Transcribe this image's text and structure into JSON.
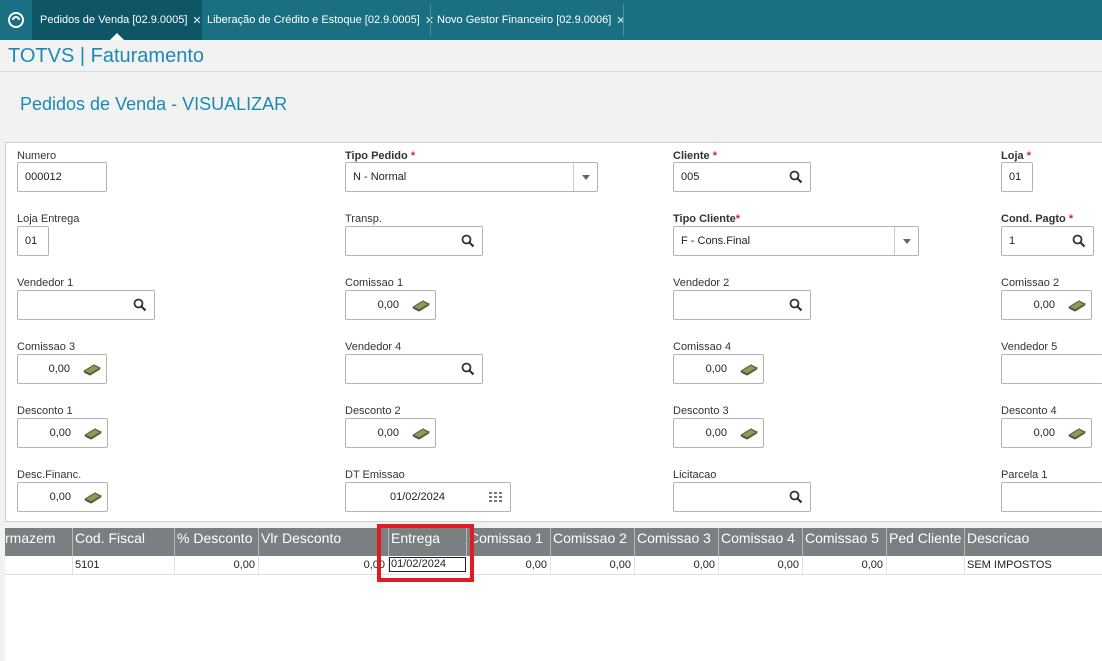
{
  "tabs": [
    {
      "label": "Pedidos de Venda [02.9.0005]",
      "active": true
    },
    {
      "label": "Liberação de Crédito e Estoque [02.9.0005]",
      "active": false
    },
    {
      "label": "Novo Gestor Financeiro [02.9.0006]",
      "active": false
    }
  ],
  "app_title": "TOTVS | Faturamento",
  "page_title": "Pedidos de Venda - VISUALIZAR",
  "form": {
    "numero": {
      "label": "Numero",
      "value": "000012"
    },
    "tipo_pedido": {
      "label": "Tipo Pedido",
      "value": "N - Normal"
    },
    "cliente": {
      "label": "Cliente",
      "value": "005"
    },
    "loja": {
      "label": "Loja",
      "value": "01"
    },
    "loja_entrega": {
      "label": "Loja Entrega",
      "value": "01"
    },
    "transp": {
      "label": "Transp.",
      "value": ""
    },
    "tipo_cliente": {
      "label": "Tipo Cliente",
      "value": "F - Cons.Final"
    },
    "cond_pagto": {
      "label": "Cond. Pagto",
      "value": "1"
    },
    "vendedor1": {
      "label": "Vendedor 1",
      "value": ""
    },
    "comissao1": {
      "label": "Comissao 1",
      "value": "0,00"
    },
    "vendedor2": {
      "label": "Vendedor 2",
      "value": ""
    },
    "comissao2": {
      "label": "Comissao 2",
      "value": "0,00"
    },
    "comissao3": {
      "label": "Comissao 3",
      "value": "0,00"
    },
    "vendedor4": {
      "label": "Vendedor 4",
      "value": ""
    },
    "comissao4": {
      "label": "Comissao 4",
      "value": "0,00"
    },
    "vendedor5": {
      "label": "Vendedor 5",
      "value": ""
    },
    "desconto1": {
      "label": "Desconto 1",
      "value": "0,00"
    },
    "desconto2": {
      "label": "Desconto 2",
      "value": "0,00"
    },
    "desconto3": {
      "label": "Desconto 3",
      "value": "0,00"
    },
    "desconto4": {
      "label": "Desconto 4",
      "value": "0,00"
    },
    "desc_financ": {
      "label": "Desc.Financ.",
      "value": "0,00"
    },
    "dt_emissao": {
      "label": "DT Emissao",
      "value": "01/02/2024"
    },
    "licitacao": {
      "label": "Licitacao",
      "value": ""
    },
    "parcela1": {
      "label": "Parcela 1",
      "value": ""
    }
  },
  "grid": {
    "columns": [
      "rmazem",
      "Cod. Fiscal",
      "% Desconto",
      "Vlr Desconto",
      "Entrega",
      "Comissao 1",
      "Comissao 2",
      "Comissao 3",
      "Comissao 4",
      "Comissao 5",
      "Ped Cliente",
      "Descricao"
    ],
    "rows": [
      [
        "",
        "5101",
        "0,00",
        "0,00",
        "01/02/2024",
        "0,00",
        "0,00",
        "0,00",
        "0,00",
        "0,00",
        "",
        "SEM IMPOSTOS"
      ]
    ]
  },
  "colors": {
    "tabbar": "#1b6f82",
    "accent": "#1a8ab5",
    "required": "#e02020",
    "highlight": "#e01b24",
    "grid_header": "#7a8082"
  }
}
